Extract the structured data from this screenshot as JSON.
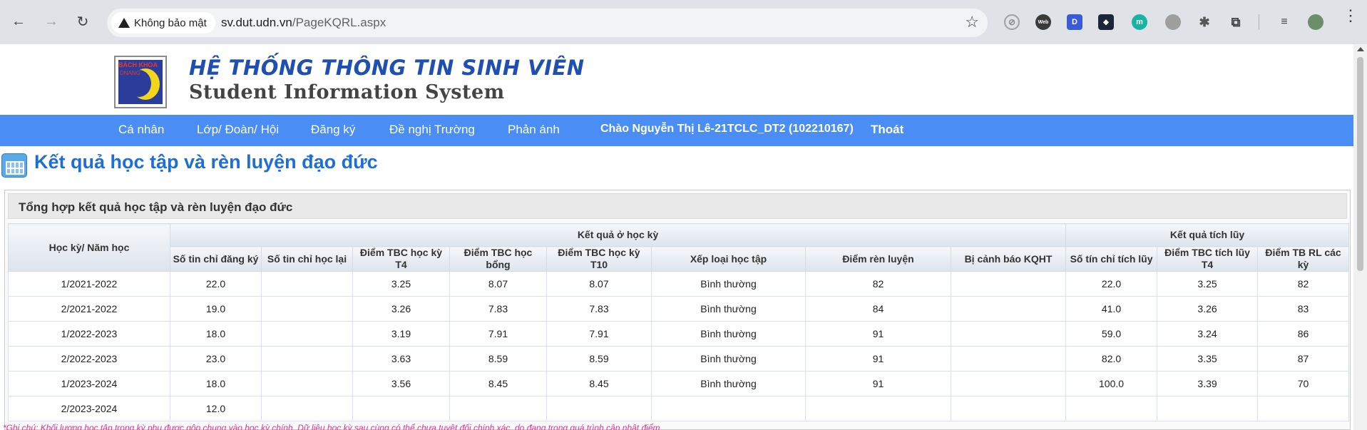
{
  "browser": {
    "security_label": "Không bảo mật",
    "url_host": "sv.dut.udn.vn",
    "url_path": "/PageKQRL.aspx",
    "extensions": [
      {
        "name": "web-ext",
        "text": "Web",
        "color": "#3a3a3a"
      },
      {
        "name": "d-ext",
        "text": "D",
        "color": "#3b5bd6"
      },
      {
        "name": "hex-ext",
        "text": "◆",
        "color": "#1d2538"
      },
      {
        "name": "m-ext",
        "text": "m",
        "color": "#17b3a3"
      }
    ]
  },
  "site": {
    "logo_top": "BÁCH KHOA",
    "logo_side": "DNANG",
    "title_vn": "HỆ THỐNG THÔNG TIN SINH VIÊN",
    "title_en": "Student Information System"
  },
  "nav": {
    "items": [
      "Cá nhân",
      "Lớp/ Đoàn/ Hội",
      "Đăng ký",
      "Đề nghị Trường",
      "Phản ánh"
    ],
    "greeting": "Chào Nguyễn Thị Lê-21TCLC_DT2 (102210167)",
    "logout": "Thoát"
  },
  "page": {
    "title": "Kết quả học tập và rèn luyện đạo đức",
    "panel_title": "Tổng hợp kết quả học tập và rèn luyện đạo đức"
  },
  "table": {
    "col_semester": "Học kỳ/ Năm học",
    "group_semester": "Kết quả ở học kỳ",
    "group_cumulative": "Kết quả tích lũy",
    "sub_headers": [
      "Số tin chỉ đăng ký",
      "Số tin chỉ học lại",
      "Điểm TBC học kỳ T4",
      "Điểm TBC học bổng",
      "Điểm TBC học kỳ T10",
      "Xếp loại học tập",
      "Điểm rèn luyện",
      "Bị cảnh báo KQHT",
      "Số tín chỉ tích lũy",
      "Điểm TBC tích lũy T4",
      "Điểm TB RL các kỳ"
    ],
    "rows": [
      [
        "1/2021-2022",
        "22.0",
        "",
        "3.25",
        "8.07",
        "8.07",
        "Bình thường",
        "82",
        "",
        "22.0",
        "3.25",
        "82"
      ],
      [
        "2/2021-2022",
        "19.0",
        "",
        "3.26",
        "7.83",
        "7.83",
        "Bình thường",
        "84",
        "",
        "41.0",
        "3.26",
        "83"
      ],
      [
        "1/2022-2023",
        "18.0",
        "",
        "3.19",
        "7.91",
        "7.91",
        "Bình thường",
        "91",
        "",
        "59.0",
        "3.24",
        "86"
      ],
      [
        "2/2022-2023",
        "23.0",
        "",
        "3.63",
        "8.59",
        "8.59",
        "Bình thường",
        "91",
        "",
        "82.0",
        "3.35",
        "87"
      ],
      [
        "1/2023-2024",
        "18.0",
        "",
        "3.56",
        "8.45",
        "8.45",
        "Bình thường",
        "91",
        "",
        "100.0",
        "3.39",
        "70"
      ],
      [
        "2/2023-2024",
        "12.0",
        "",
        "",
        "",
        "",
        "",
        "",
        "",
        "",
        "",
        ""
      ]
    ]
  },
  "note": "*Ghi chú: Khối lượng học tập trong kỳ phụ được gộp chung vào học kỳ chính. Dữ liệu học kỳ sau cùng có thể chưa tuyệt đối chính xác, do đang trong quá trình cập nhật điểm."
}
